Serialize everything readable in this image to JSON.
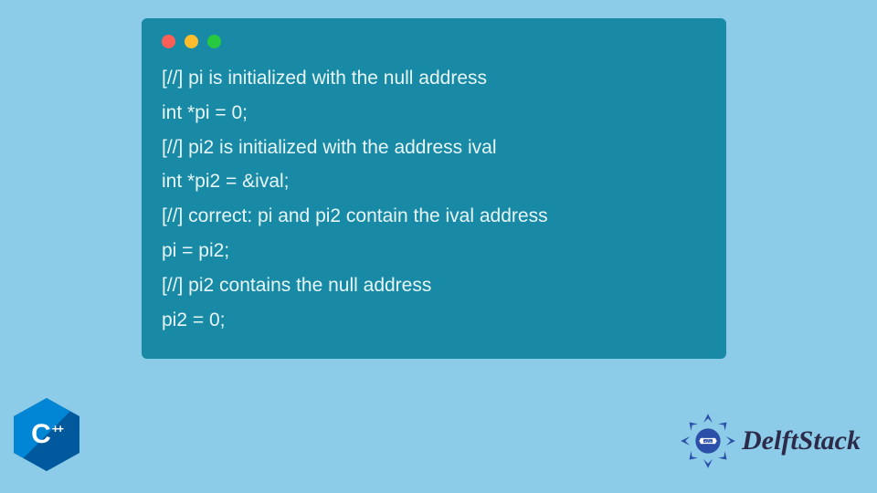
{
  "code": {
    "lines": [
      "[//] pi is initialized with the null address",
      "int *pi = 0;",
      "[//] pi2 is initialized with the address ival",
      "int *pi2 = &ival;",
      "[//] correct: pi and pi2 contain the ival address",
      "pi = pi2;",
      "[//] pi2 contains the null address",
      "pi2 = 0;"
    ]
  },
  "cpp_logo": {
    "letter": "C",
    "plus": "++"
  },
  "brand": {
    "name_a": "Delft",
    "name_b": "Stack"
  }
}
